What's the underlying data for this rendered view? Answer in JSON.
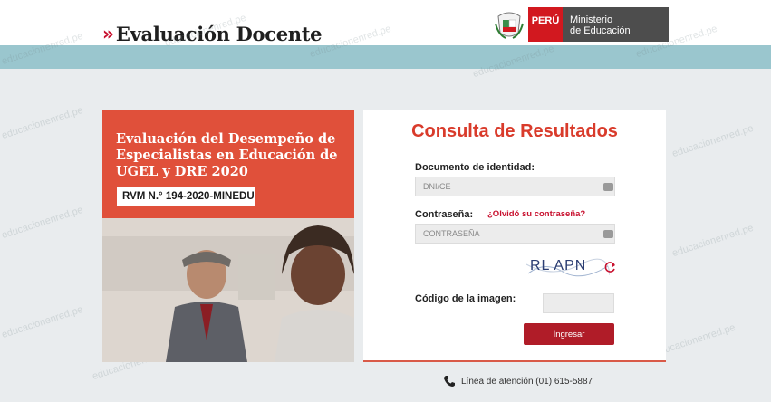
{
  "header": {
    "brand_mark": "»",
    "brand_title": "Evaluación Docente",
    "peru_label": "PERÚ",
    "ministry_line1": "Ministerio",
    "ministry_line2": "de Educación"
  },
  "promo": {
    "title": "Evaluación del Desempeño de Especialistas en Educación de UGEL y DRE 2020",
    "resolution": "RVM N.° 194-2020-MINEDU"
  },
  "form": {
    "title": "Consulta de Resultados",
    "document_label": "Documento de identidad:",
    "document_placeholder": "DNI/CE",
    "password_label": "Contraseña:",
    "forgot_link": "¿Olvidó su contraseña?",
    "password_placeholder": "CONTRASEÑA",
    "captcha_text": "RL APN",
    "code_label": "Código de la imagen:",
    "submit_label": "Ingresar"
  },
  "helpline": {
    "text": "Línea de atención (01) 615-5887"
  },
  "watermark_text": "educacionenred.pe",
  "colors": {
    "brand_red": "#c8102e",
    "promo_orange": "#e0503a",
    "button_red": "#b01c28",
    "band_teal": "#9ac6ce"
  }
}
